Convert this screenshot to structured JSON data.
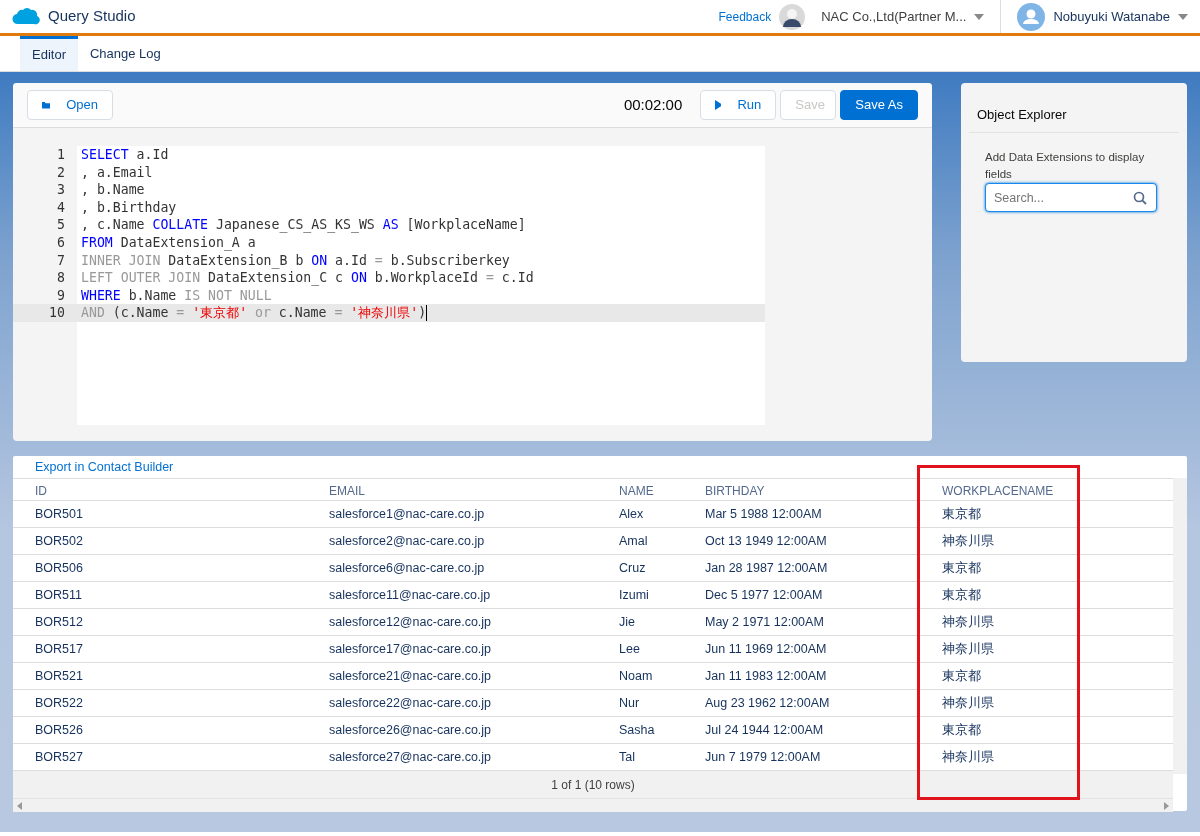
{
  "app": {
    "title": "Query Studio"
  },
  "header": {
    "feedback": "Feedback",
    "org": "NAC Co.,Ltd(Partner M...",
    "user": "Nobuyuki Watanabe"
  },
  "tabs": [
    {
      "label": "Editor",
      "selected": true
    },
    {
      "label": "Change Log",
      "selected": false
    }
  ],
  "toolbar": {
    "buttons": [
      {
        "label": "Open",
        "kind": "open",
        "disabled": false
      },
      {
        "label": "Run",
        "kind": "run",
        "disabled": false
      },
      {
        "label": "Save",
        "kind": "plain",
        "disabled": true
      },
      {
        "label": "Save As",
        "kind": "brand",
        "disabled": false
      }
    ],
    "timer": "00:02:00"
  },
  "editor": {
    "lines": [
      {
        "number": "1",
        "active": false,
        "tokens": [
          {
            "kind": "kw",
            "text": "SELECT"
          },
          {
            "kind": "text",
            "text": " a.Id"
          }
        ]
      },
      {
        "number": "2",
        "active": false,
        "tokens": [
          {
            "kind": "text",
            "text": ", a.Email"
          }
        ]
      },
      {
        "number": "3",
        "active": false,
        "tokens": [
          {
            "kind": "text",
            "text": ", b.Name"
          }
        ]
      },
      {
        "number": "4",
        "active": false,
        "tokens": [
          {
            "kind": "text",
            "text": ", b.Birthday"
          }
        ]
      },
      {
        "number": "5",
        "active": false,
        "tokens": [
          {
            "kind": "text",
            "text": ", c.Name "
          },
          {
            "kind": "kw",
            "text": "COLLATE"
          },
          {
            "kind": "text",
            "text": " Japanese_CS_AS_KS_WS "
          },
          {
            "kind": "kw",
            "text": "AS"
          },
          {
            "kind": "text",
            "text": " [WorkplaceName]"
          }
        ]
      },
      {
        "number": "6",
        "active": false,
        "tokens": [
          {
            "kind": "kw",
            "text": "FROM"
          },
          {
            "kind": "text",
            "text": " DataExtension_A a"
          }
        ]
      },
      {
        "number": "7",
        "active": false,
        "tokens": [
          {
            "kind": "op",
            "text": "INNER JOIN"
          },
          {
            "kind": "text",
            "text": " DataExtension_B b "
          },
          {
            "kind": "kw",
            "text": "ON"
          },
          {
            "kind": "text",
            "text": " a.Id "
          },
          {
            "kind": "op",
            "text": "="
          },
          {
            "kind": "text",
            "text": " b.Subscriberkey"
          }
        ]
      },
      {
        "number": "8",
        "active": false,
        "tokens": [
          {
            "kind": "op",
            "text": "LEFT OUTER JOIN"
          },
          {
            "kind": "text",
            "text": " DataExtension_C c "
          },
          {
            "kind": "kw",
            "text": "ON"
          },
          {
            "kind": "text",
            "text": " b.WorkplaceId "
          },
          {
            "kind": "op",
            "text": "="
          },
          {
            "kind": "text",
            "text": " c.Id"
          }
        ]
      },
      {
        "number": "9",
        "active": false,
        "tokens": [
          {
            "kind": "kw",
            "text": "WHERE"
          },
          {
            "kind": "text",
            "text": " b.Name "
          },
          {
            "kind": "op",
            "text": "IS NOT NULL"
          }
        ]
      },
      {
        "number": "10",
        "active": true,
        "tokens": [
          {
            "kind": "op",
            "text": "AND"
          },
          {
            "kind": "text",
            "text": " (c.Name "
          },
          {
            "kind": "op",
            "text": "= "
          },
          {
            "kind": "str",
            "text": "'東京都' "
          },
          {
            "kind": "op",
            "text": "or"
          },
          {
            "kind": "text",
            "text": " c.Name "
          },
          {
            "kind": "op",
            "text": "= "
          },
          {
            "kind": "str",
            "text": "'神奈川県'"
          },
          {
            "kind": "text",
            "text": ")"
          }
        ]
      }
    ]
  },
  "object_explorer": {
    "title": "Object Explorer",
    "hint": "Add Data Extensions to display fields",
    "search": {
      "placeholder": "Search..."
    }
  },
  "results": {
    "export_link": "Export in Contact Builder",
    "columns": [
      {
        "label": "ID",
        "highlighted": false
      },
      {
        "label": "EMAIL",
        "highlighted": false
      },
      {
        "label": "NAME",
        "highlighted": false
      },
      {
        "label": "BIRTHDAY",
        "highlighted": false
      },
      {
        "label": "WORKPLACENAME",
        "highlighted": true
      }
    ],
    "rows": [
      [
        "BOR501",
        "salesforce1@nac-care.co.jp",
        "Alex",
        "Mar 5 1988 12:00AM",
        "東京都"
      ],
      [
        "BOR502",
        "salesforce2@nac-care.co.jp",
        "Amal",
        "Oct 13 1949 12:00AM",
        "神奈川県"
      ],
      [
        "BOR506",
        "salesforce6@nac-care.co.jp",
        "Cruz",
        "Jan 28 1987 12:00AM",
        "東京都"
      ],
      [
        "BOR511",
        "salesforce11@nac-care.co.jp",
        "Izumi",
        "Dec 5 1977 12:00AM",
        "東京都"
      ],
      [
        "BOR512",
        "salesforce12@nac-care.co.jp",
        "Jie",
        "May 2 1971 12:00AM",
        "神奈川県"
      ],
      [
        "BOR517",
        "salesforce17@nac-care.co.jp",
        "Lee",
        "Jun 11 1969 12:00AM",
        "神奈川県"
      ],
      [
        "BOR521",
        "salesforce21@nac-care.co.jp",
        "Noam",
        "Jan 11 1983 12:00AM",
        "東京都"
      ],
      [
        "BOR522",
        "salesforce22@nac-care.co.jp",
        "Nur",
        "Aug 23 1962 12:00AM",
        "神奈川県"
      ],
      [
        "BOR526",
        "salesforce26@nac-care.co.jp",
        "Sasha",
        "Jul 24 1944 12:00AM",
        "東京都"
      ],
      [
        "BOR527",
        "salesforce27@nac-care.co.jp",
        "Tal",
        "Jun 7 1979 12:00AM",
        "神奈川県"
      ]
    ],
    "pager": "1 of 1 (10 rows)"
  }
}
